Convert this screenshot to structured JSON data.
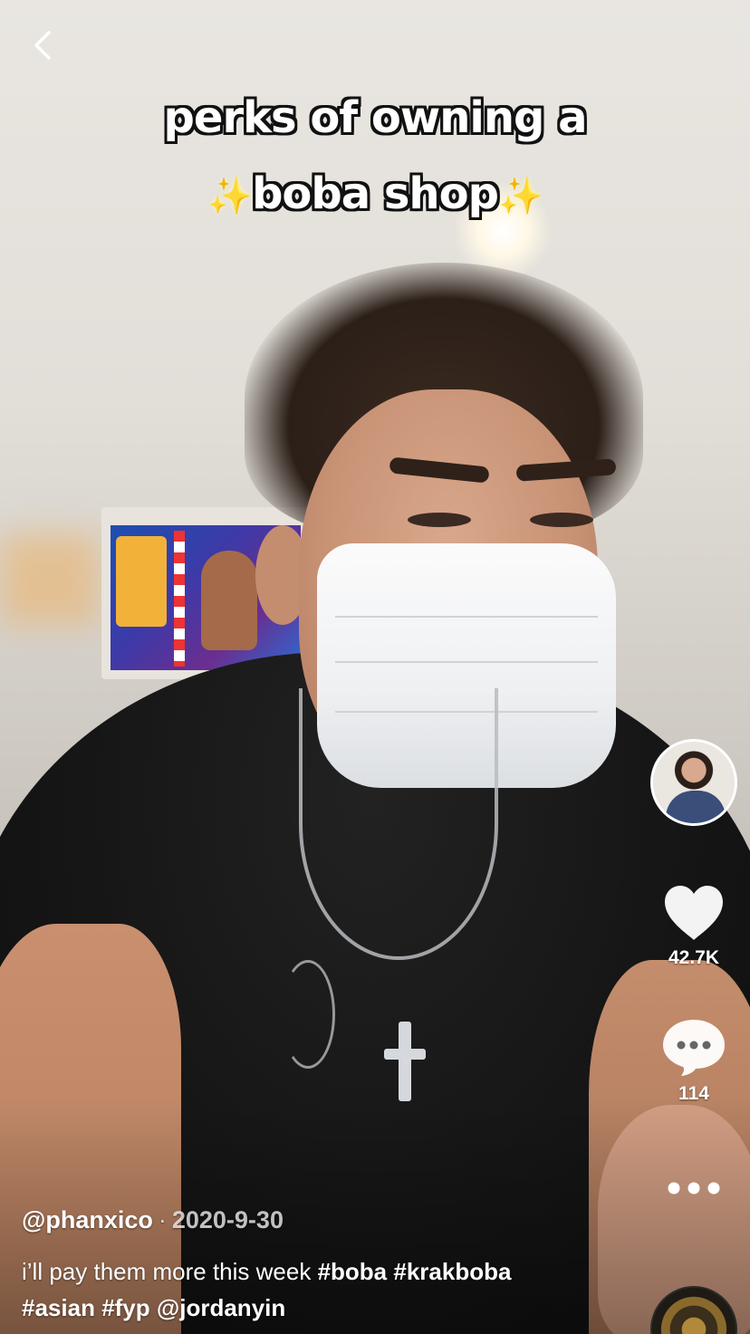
{
  "header": {
    "back_icon": "chevron-left-icon"
  },
  "overlay_caption": {
    "line1": "perks of owning a",
    "line2": "boba shop",
    "sparkle": "✨"
  },
  "rail": {
    "avatar_icon": "creator-avatar",
    "likes": "42.7K",
    "like_icon": "heart-icon",
    "comments": "114",
    "comment_icon": "comment-bubble-icon",
    "more_icon": "more-dots-icon",
    "music_icon": "music-disc-icon"
  },
  "post": {
    "username": "@phanxico",
    "separator": "·",
    "date": "2020-9-30",
    "description_text": "i’ll pay them more this week",
    "tags": [
      "#boba",
      "#krakboba",
      "#asian",
      "#fyp"
    ],
    "mention": "@jordanyin"
  }
}
